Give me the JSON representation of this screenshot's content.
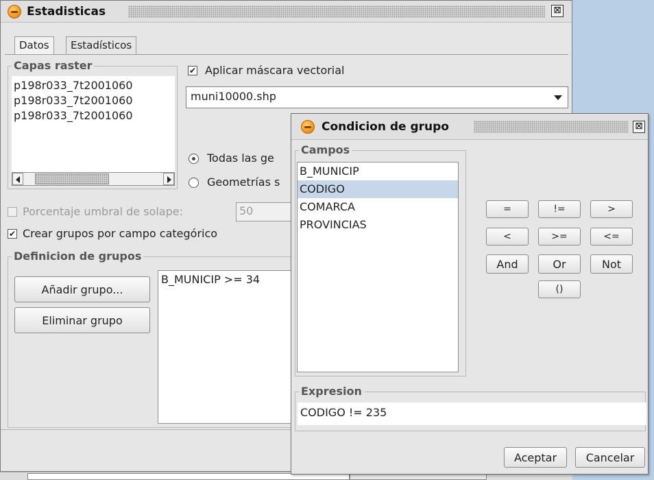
{
  "main_window": {
    "title": "Estadisticas",
    "close_glyph": "⊠",
    "tabs": [
      {
        "label": "Datos",
        "active": true
      },
      {
        "label": "Estadísticos",
        "active": false
      }
    ],
    "capas_raster": {
      "legend": "Capas raster",
      "items": [
        "p198r033_7t2001060",
        "p198r033_7t2001060",
        "p198r033_7t2001060"
      ]
    },
    "aplicar_mascara": {
      "label": "Aplicar máscara vectorial",
      "checked": true
    },
    "mask_layer": {
      "value": "muni10000.shp"
    },
    "radio_todas": {
      "label": "Todas las ge",
      "checked": true
    },
    "radio_geometrias": {
      "label": "Geometrías s",
      "checked": false
    },
    "porcentaje": {
      "label": "Porcentaje umbral de solape:",
      "value": "50",
      "enabled": false
    },
    "crear_grupos": {
      "label": "Crear grupos por campo categórico",
      "checked": true
    },
    "definicion_grupos": {
      "legend": "Definicion de grupos",
      "add_button": "Añadir grupo...",
      "remove_button": "Eliminar grupo",
      "groups": [
        "B_MUNICIP >= 34"
      ]
    }
  },
  "dialog": {
    "title": "Condicion de grupo",
    "close_glyph": "⊠",
    "campos": {
      "legend": "Campos",
      "items": [
        "B_MUNICIP",
        "CODIGO",
        "COMARCA",
        "PROVINCIAS"
      ],
      "selected_index": 1
    },
    "operators": {
      "eq": "=",
      "neq": "!=",
      "gt": ">",
      "lt": "<",
      "gte": ">=",
      "lte": "<=",
      "and": "And",
      "or": "Or",
      "not": "Not",
      "parens": "()"
    },
    "expresion": {
      "legend": "Expresion",
      "value": "CODIGO != 235"
    },
    "accept_button": "Aceptar",
    "cancel_button": "Cancelar"
  },
  "colors": {
    "window_bg": "#e6e6e6",
    "desktop_blue": "#b8cfe5",
    "selection": "#c7d7ea"
  }
}
